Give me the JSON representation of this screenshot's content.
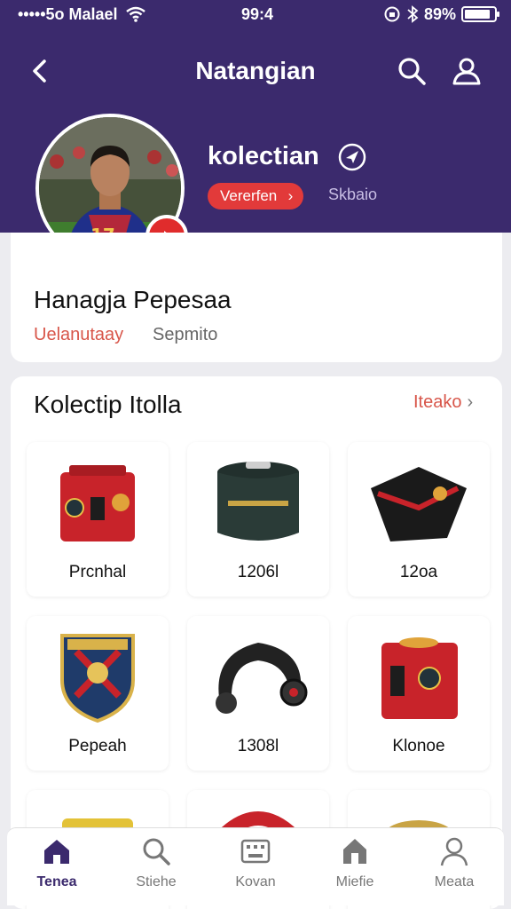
{
  "status_bar": {
    "carrier": "•••••5o Malael",
    "time": "99:4",
    "battery": "89%",
    "battery_level": 0.89
  },
  "nav": {
    "title": "Natangian"
  },
  "profile": {
    "name": "kolectian",
    "tag": "Vererfen",
    "tag_link": "Skbaio"
  },
  "owner": {
    "name": "Hanagja Pepesaa",
    "subtitle": "Uelanutaay",
    "status": "Sepmito"
  },
  "collection": {
    "title": "Kolectip Itolla",
    "see_all": "Iteako",
    "items": [
      {
        "label": "Prcnhal",
        "icon": "red-safe-icon"
      },
      {
        "label": "1206l",
        "icon": "dark-bag-icon"
      },
      {
        "label": "12oa",
        "icon": "black-jersey-icon"
      },
      {
        "label": "Pepeah",
        "icon": "club-crest-icon"
      },
      {
        "label": "1308l",
        "icon": "headband-icon"
      },
      {
        "label": "Klonoe",
        "icon": "red-box-icon"
      },
      {
        "label": "",
        "icon": "yellow-case-icon"
      },
      {
        "label": "",
        "icon": "red-watch-icon"
      },
      {
        "label": "",
        "icon": "gold-badge-icon"
      }
    ]
  },
  "tabs": [
    {
      "label": "Tenea",
      "icon": "home-icon",
      "active": true
    },
    {
      "label": "Stiehe",
      "icon": "search-icon",
      "active": false
    },
    {
      "label": "Kovan",
      "icon": "keyboard-icon",
      "active": false
    },
    {
      "label": "Miefie",
      "icon": "shop-icon",
      "active": false
    },
    {
      "label": "Meata",
      "icon": "user-icon",
      "active": false
    }
  ],
  "colors": {
    "header": "#3b2a6d",
    "accent": "#e23a3a",
    "link": "#d8564a"
  }
}
